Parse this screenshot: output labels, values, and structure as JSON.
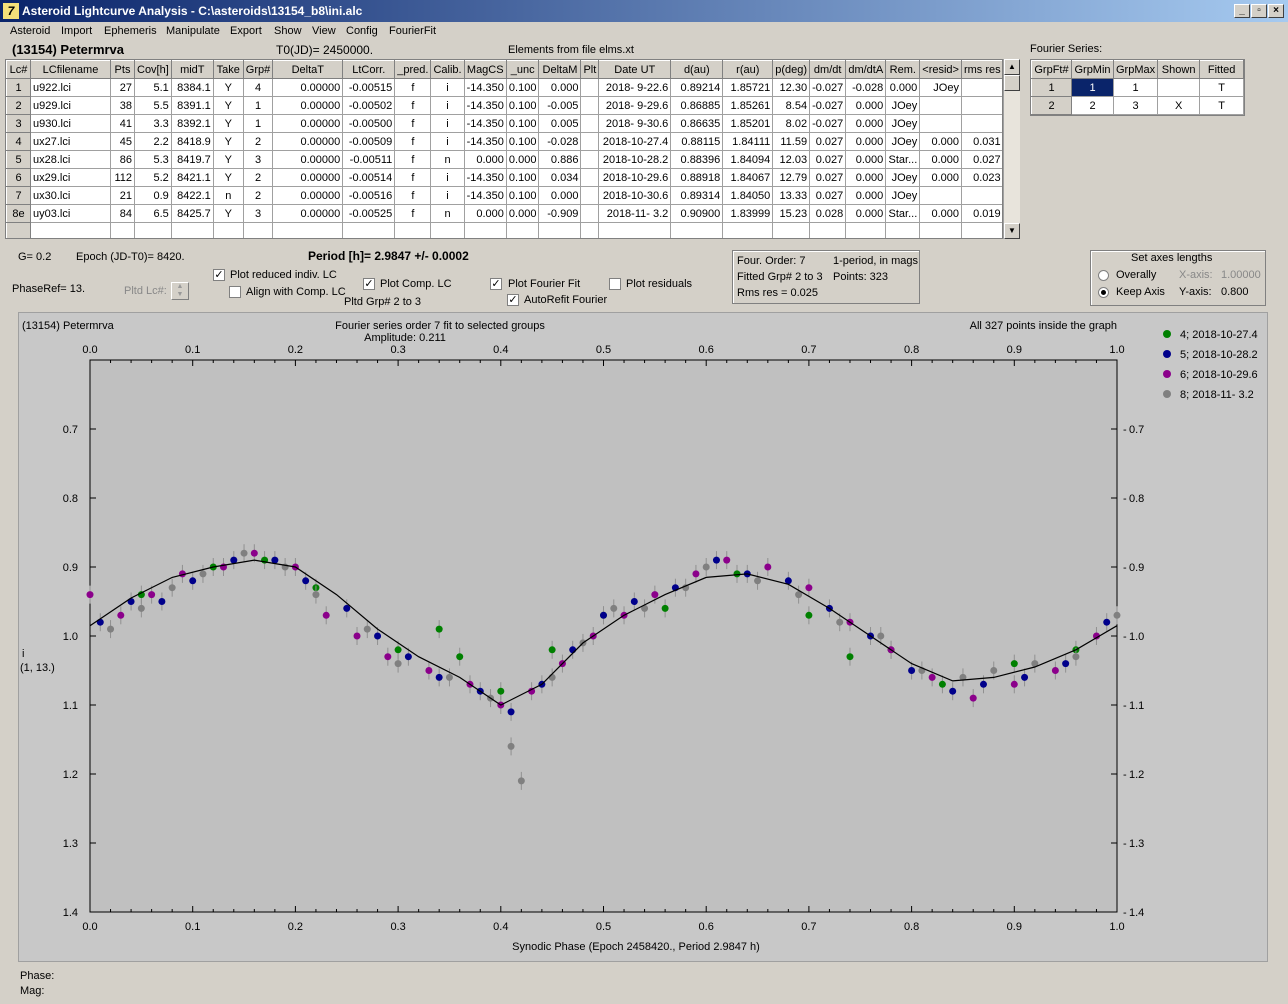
{
  "window": {
    "title": "Asteroid Lightcurve Analysis - C:\\asteroids\\13154_b8\\ini.alc",
    "icon_glyph": "7"
  },
  "menu": [
    "Asteroid",
    "Import",
    "Ephemeris",
    "Manipulate",
    "Export",
    "Show",
    "View",
    "Config",
    "FourierFit"
  ],
  "header": {
    "asteroid": "(13154) Petermrva",
    "t0": "T0(JD)= 2450000.",
    "elements": "Elements from file elms.xt"
  },
  "lc_table": {
    "columns": [
      "Lc#",
      "LCfilename",
      "Pts",
      "Cov[h]",
      "midT",
      "Take",
      "Grp#",
      "DeltaT",
      "LtCorr.",
      "_pred.",
      "Calib.",
      "MagCS",
      "_unc",
      "DeltaM",
      "Plt",
      "Date UT",
      "d(au)",
      "r(au)",
      "p(deg)",
      "dm/dt",
      "dm/dtA",
      "Rem.",
      "<resid>",
      "rms res"
    ],
    "rows": [
      [
        "1",
        "u922.lci",
        "27",
        "5.1",
        "8384.1",
        "Y",
        "4",
        "0.00000",
        "-0.00515",
        "f",
        "i",
        "-14.350",
        "0.100",
        "0.000",
        "",
        "2018- 9-22.6",
        "0.89214",
        "1.85721",
        "12.30",
        "-0.027",
        "-0.028",
        "0.000",
        "JOey",
        "",
        ""
      ],
      [
        "2",
        "u929.lci",
        "38",
        "5.5",
        "8391.1",
        "Y",
        "1",
        "0.00000",
        "-0.00502",
        "f",
        "i",
        "-14.350",
        "0.100",
        "-0.005",
        "",
        "2018- 9-29.6",
        "0.86885",
        "1.85261",
        "8.54",
        "-0.027",
        "0.000",
        "JOey",
        "",
        ""
      ],
      [
        "3",
        "u930.lci",
        "41",
        "3.3",
        "8392.1",
        "Y",
        "1",
        "0.00000",
        "-0.00500",
        "f",
        "i",
        "-14.350",
        "0.100",
        "0.005",
        "",
        "2018- 9-30.6",
        "0.86635",
        "1.85201",
        "8.02",
        "-0.027",
        "0.000",
        "JOey",
        "",
        ""
      ],
      [
        "4",
        "ux27.lci",
        "45",
        "2.2",
        "8418.9",
        "Y",
        "2",
        "0.00000",
        "-0.00509",
        "f",
        "i",
        "-14.350",
        "0.100",
        "-0.028",
        "",
        "2018-10-27.4",
        "0.88115",
        "1.84111",
        "11.59",
        "0.027",
        "0.000",
        "JOey",
        "0.000",
        "0.031"
      ],
      [
        "5",
        "ux28.lci",
        "86",
        "5.3",
        "8419.7",
        "Y",
        "3",
        "0.00000",
        "-0.00511",
        "f",
        "n",
        "0.000",
        "0.000",
        "0.886",
        "",
        "2018-10-28.2",
        "0.88396",
        "1.84094",
        "12.03",
        "0.027",
        "0.000",
        "Star...",
        "0.000",
        "0.027"
      ],
      [
        "6",
        "ux29.lci",
        "112",
        "5.2",
        "8421.1",
        "Y",
        "2",
        "0.00000",
        "-0.00514",
        "f",
        "i",
        "-14.350",
        "0.100",
        "0.034",
        "",
        "2018-10-29.6",
        "0.88918",
        "1.84067",
        "12.79",
        "0.027",
        "0.000",
        "JOey",
        "0.000",
        "0.023"
      ],
      [
        "7",
        "ux30.lci",
        "21",
        "0.9",
        "8422.1",
        "n",
        "2",
        "0.00000",
        "-0.00516",
        "f",
        "i",
        "-14.350",
        "0.100",
        "0.000",
        "",
        "2018-10-30.6",
        "0.89314",
        "1.84050",
        "13.33",
        "0.027",
        "0.000",
        "JOey",
        "",
        ""
      ],
      [
        "8e",
        "uy03.lci",
        "84",
        "6.5",
        "8425.7",
        "Y",
        "3",
        "0.00000",
        "-0.00525",
        "f",
        "n",
        "0.000",
        "0.000",
        "-0.909",
        "",
        "2018-11- 3.2",
        "0.90900",
        "1.83999",
        "15.23",
        "0.028",
        "0.000",
        "Star...",
        "0.000",
        "0.019"
      ]
    ]
  },
  "fourier_series": {
    "label": "Fourier Series:",
    "columns": [
      "GrpFt#",
      "GrpMin",
      "GrpMax",
      "Shown",
      "Fitted"
    ],
    "rows": [
      [
        "1",
        "1",
        "1",
        "",
        "T"
      ],
      [
        "2",
        "2",
        "3",
        "X",
        "T"
      ]
    ]
  },
  "info": {
    "g": "G= 0.2",
    "epoch": "Epoch (JD-T0)= 8420.",
    "period": "Period [h]= 2.9847 +/- 0.0002",
    "phaseref": "PhaseRef= 13.",
    "pltd_lc": "Pltd Lc#:",
    "pltd_grp": "Pltd Grp#  2   to   3"
  },
  "options": {
    "plot_reduced": {
      "label": "Plot reduced indiv. LC",
      "checked": true
    },
    "align_comp": {
      "label": "Align with Comp. LC",
      "checked": false
    },
    "plot_comp": {
      "label": "Plot Comp. LC",
      "checked": true
    },
    "plot_fourier": {
      "label": "Plot Fourier Fit",
      "checked": true
    },
    "autorefit": {
      "label": "AutoRefit Fourier",
      "checked": true
    },
    "plot_residuals": {
      "label": "Plot residuals",
      "checked": false
    }
  },
  "fit_box": {
    "order": "Four. Order:  7",
    "period_in_mags": "1-period, in mags",
    "fitted": "Fitted Grp# 2 to 3",
    "points": "Points: 323",
    "rms": "Rms res      = 0.025"
  },
  "axes_box": {
    "title": "Set axes lengths",
    "overall": "Overally",
    "keep": "Keep Axis",
    "xaxis_label": "X-axis:",
    "xaxis_value": "1.00000",
    "yaxis_label": "Y-axis:",
    "yaxis_value": "0.800"
  },
  "plot": {
    "top_left": "(13154) Petermrva",
    "title": "Fourier series order 7 fit to selected groups",
    "amplitude": "Amplitude: 0.211",
    "top_right": "All 327 points inside the graph",
    "ylabel": "i",
    "ylabel2": "(1, 13.)",
    "bottom_label": "Synodic Phase (Epoch 2458420., Period 2.9847 h)",
    "phase_label": "Phase:",
    "mag_label": "Mag:"
  },
  "chart_data": {
    "type": "scatter",
    "xlabel": "Synodic Phase (Epoch 2458420., Period 2.9847 h)",
    "ylabel": "i",
    "xlim": [
      0,
      1
    ],
    "ylim": [
      1.4,
      0.6
    ],
    "y_inverted": true,
    "xticks": [
      "0.0",
      "0.1",
      "0.2",
      "0.3",
      "0.4",
      "0.5",
      "0.6",
      "0.7",
      "0.8",
      "0.9",
      "1.0"
    ],
    "yticks": [
      "0.7",
      "0.8",
      "0.9",
      "1.0",
      "1.1",
      "1.2",
      "1.3",
      "1.4"
    ],
    "legend_position": "right",
    "series": [
      {
        "name": "4; 2018-10-27.4",
        "color": "#008000",
        "points": [
          [
            0.22,
            0.93
          ],
          [
            0.3,
            1.02
          ],
          [
            0.34,
            0.99
          ],
          [
            0.36,
            1.03
          ],
          [
            0.4,
            1.08
          ],
          [
            0.45,
            1.02
          ],
          [
            0.5,
            0.97
          ],
          [
            0.56,
            0.96
          ],
          [
            0.63,
            0.91
          ],
          [
            0.7,
            0.97
          ],
          [
            0.74,
            1.03
          ],
          [
            0.78,
            1.02
          ],
          [
            0.83,
            1.07
          ],
          [
            0.9,
            1.04
          ],
          [
            0.96,
            1.02
          ],
          [
            0.05,
            0.94
          ],
          [
            0.12,
            0.9
          ],
          [
            0.17,
            0.89
          ]
        ]
      },
      {
        "name": "5; 2018-10-28.2",
        "color": "#00008b",
        "points": [
          [
            0.01,
            0.98
          ],
          [
            0.04,
            0.95
          ],
          [
            0.07,
            0.95
          ],
          [
            0.1,
            0.92
          ],
          [
            0.14,
            0.89
          ],
          [
            0.18,
            0.89
          ],
          [
            0.21,
            0.92
          ],
          [
            0.25,
            0.96
          ],
          [
            0.28,
            1.0
          ],
          [
            0.31,
            1.03
          ],
          [
            0.34,
            1.06
          ],
          [
            0.38,
            1.08
          ],
          [
            0.41,
            1.11
          ],
          [
            0.44,
            1.07
          ],
          [
            0.47,
            1.02
          ],
          [
            0.5,
            0.97
          ],
          [
            0.53,
            0.95
          ],
          [
            0.57,
            0.93
          ],
          [
            0.61,
            0.89
          ],
          [
            0.64,
            0.91
          ],
          [
            0.68,
            0.92
          ],
          [
            0.72,
            0.96
          ],
          [
            0.76,
            1.0
          ],
          [
            0.8,
            1.05
          ],
          [
            0.84,
            1.08
          ],
          [
            0.87,
            1.07
          ],
          [
            0.91,
            1.06
          ],
          [
            0.95,
            1.04
          ],
          [
            0.99,
            0.98
          ]
        ]
      },
      {
        "name": "6; 2018-10-29.6",
        "color": "#8b008b",
        "points": [
          [
            0.0,
            0.94
          ],
          [
            0.03,
            0.97
          ],
          [
            0.06,
            0.94
          ],
          [
            0.09,
            0.91
          ],
          [
            0.13,
            0.9
          ],
          [
            0.16,
            0.88
          ],
          [
            0.2,
            0.9
          ],
          [
            0.23,
            0.97
          ],
          [
            0.26,
            1.0
          ],
          [
            0.29,
            1.03
          ],
          [
            0.33,
            1.05
          ],
          [
            0.37,
            1.07
          ],
          [
            0.4,
            1.1
          ],
          [
            0.43,
            1.08
          ],
          [
            0.46,
            1.04
          ],
          [
            0.49,
            1.0
          ],
          [
            0.52,
            0.97
          ],
          [
            0.55,
            0.94
          ],
          [
            0.59,
            0.91
          ],
          [
            0.62,
            0.89
          ],
          [
            0.66,
            0.9
          ],
          [
            0.7,
            0.93
          ],
          [
            0.74,
            0.98
          ],
          [
            0.78,
            1.02
          ],
          [
            0.82,
            1.06
          ],
          [
            0.86,
            1.09
          ],
          [
            0.9,
            1.07
          ],
          [
            0.94,
            1.05
          ],
          [
            0.98,
            1.0
          ]
        ]
      },
      {
        "name": "8; 2018-11- 3.2",
        "color": "#808080",
        "points": [
          [
            0.02,
            0.99
          ],
          [
            0.05,
            0.96
          ],
          [
            0.08,
            0.93
          ],
          [
            0.11,
            0.91
          ],
          [
            0.15,
            0.88
          ],
          [
            0.19,
            0.9
          ],
          [
            0.22,
            0.94
          ],
          [
            0.27,
            0.99
          ],
          [
            0.3,
            1.04
          ],
          [
            0.35,
            1.06
          ],
          [
            0.39,
            1.09
          ],
          [
            0.41,
            1.16
          ],
          [
            0.42,
            1.21
          ],
          [
            0.45,
            1.06
          ],
          [
            0.48,
            1.01
          ],
          [
            0.51,
            0.96
          ],
          [
            0.54,
            0.96
          ],
          [
            0.58,
            0.93
          ],
          [
            0.6,
            0.9
          ],
          [
            0.65,
            0.92
          ],
          [
            0.69,
            0.94
          ],
          [
            0.73,
            0.98
          ],
          [
            0.77,
            1.0
          ],
          [
            0.81,
            1.05
          ],
          [
            0.85,
            1.06
          ],
          [
            0.88,
            1.05
          ],
          [
            0.92,
            1.04
          ],
          [
            0.96,
            1.03
          ],
          [
            1.0,
            0.97
          ]
        ]
      }
    ],
    "fit_curve": [
      [
        0,
        0.985
      ],
      [
        0.04,
        0.945
      ],
      [
        0.08,
        0.915
      ],
      [
        0.12,
        0.9
      ],
      [
        0.16,
        0.89
      ],
      [
        0.2,
        0.9
      ],
      [
        0.24,
        0.94
      ],
      [
        0.28,
        0.99
      ],
      [
        0.32,
        1.03
      ],
      [
        0.36,
        1.06
      ],
      [
        0.4,
        1.1
      ],
      [
        0.44,
        1.07
      ],
      [
        0.48,
        1.01
      ],
      [
        0.52,
        0.97
      ],
      [
        0.56,
        0.94
      ],
      [
        0.6,
        0.915
      ],
      [
        0.64,
        0.91
      ],
      [
        0.68,
        0.925
      ],
      [
        0.72,
        0.96
      ],
      [
        0.76,
        1.0
      ],
      [
        0.8,
        1.04
      ],
      [
        0.84,
        1.065
      ],
      [
        0.88,
        1.06
      ],
      [
        0.92,
        1.045
      ],
      [
        0.96,
        1.02
      ],
      [
        1.0,
        0.985
      ]
    ]
  }
}
